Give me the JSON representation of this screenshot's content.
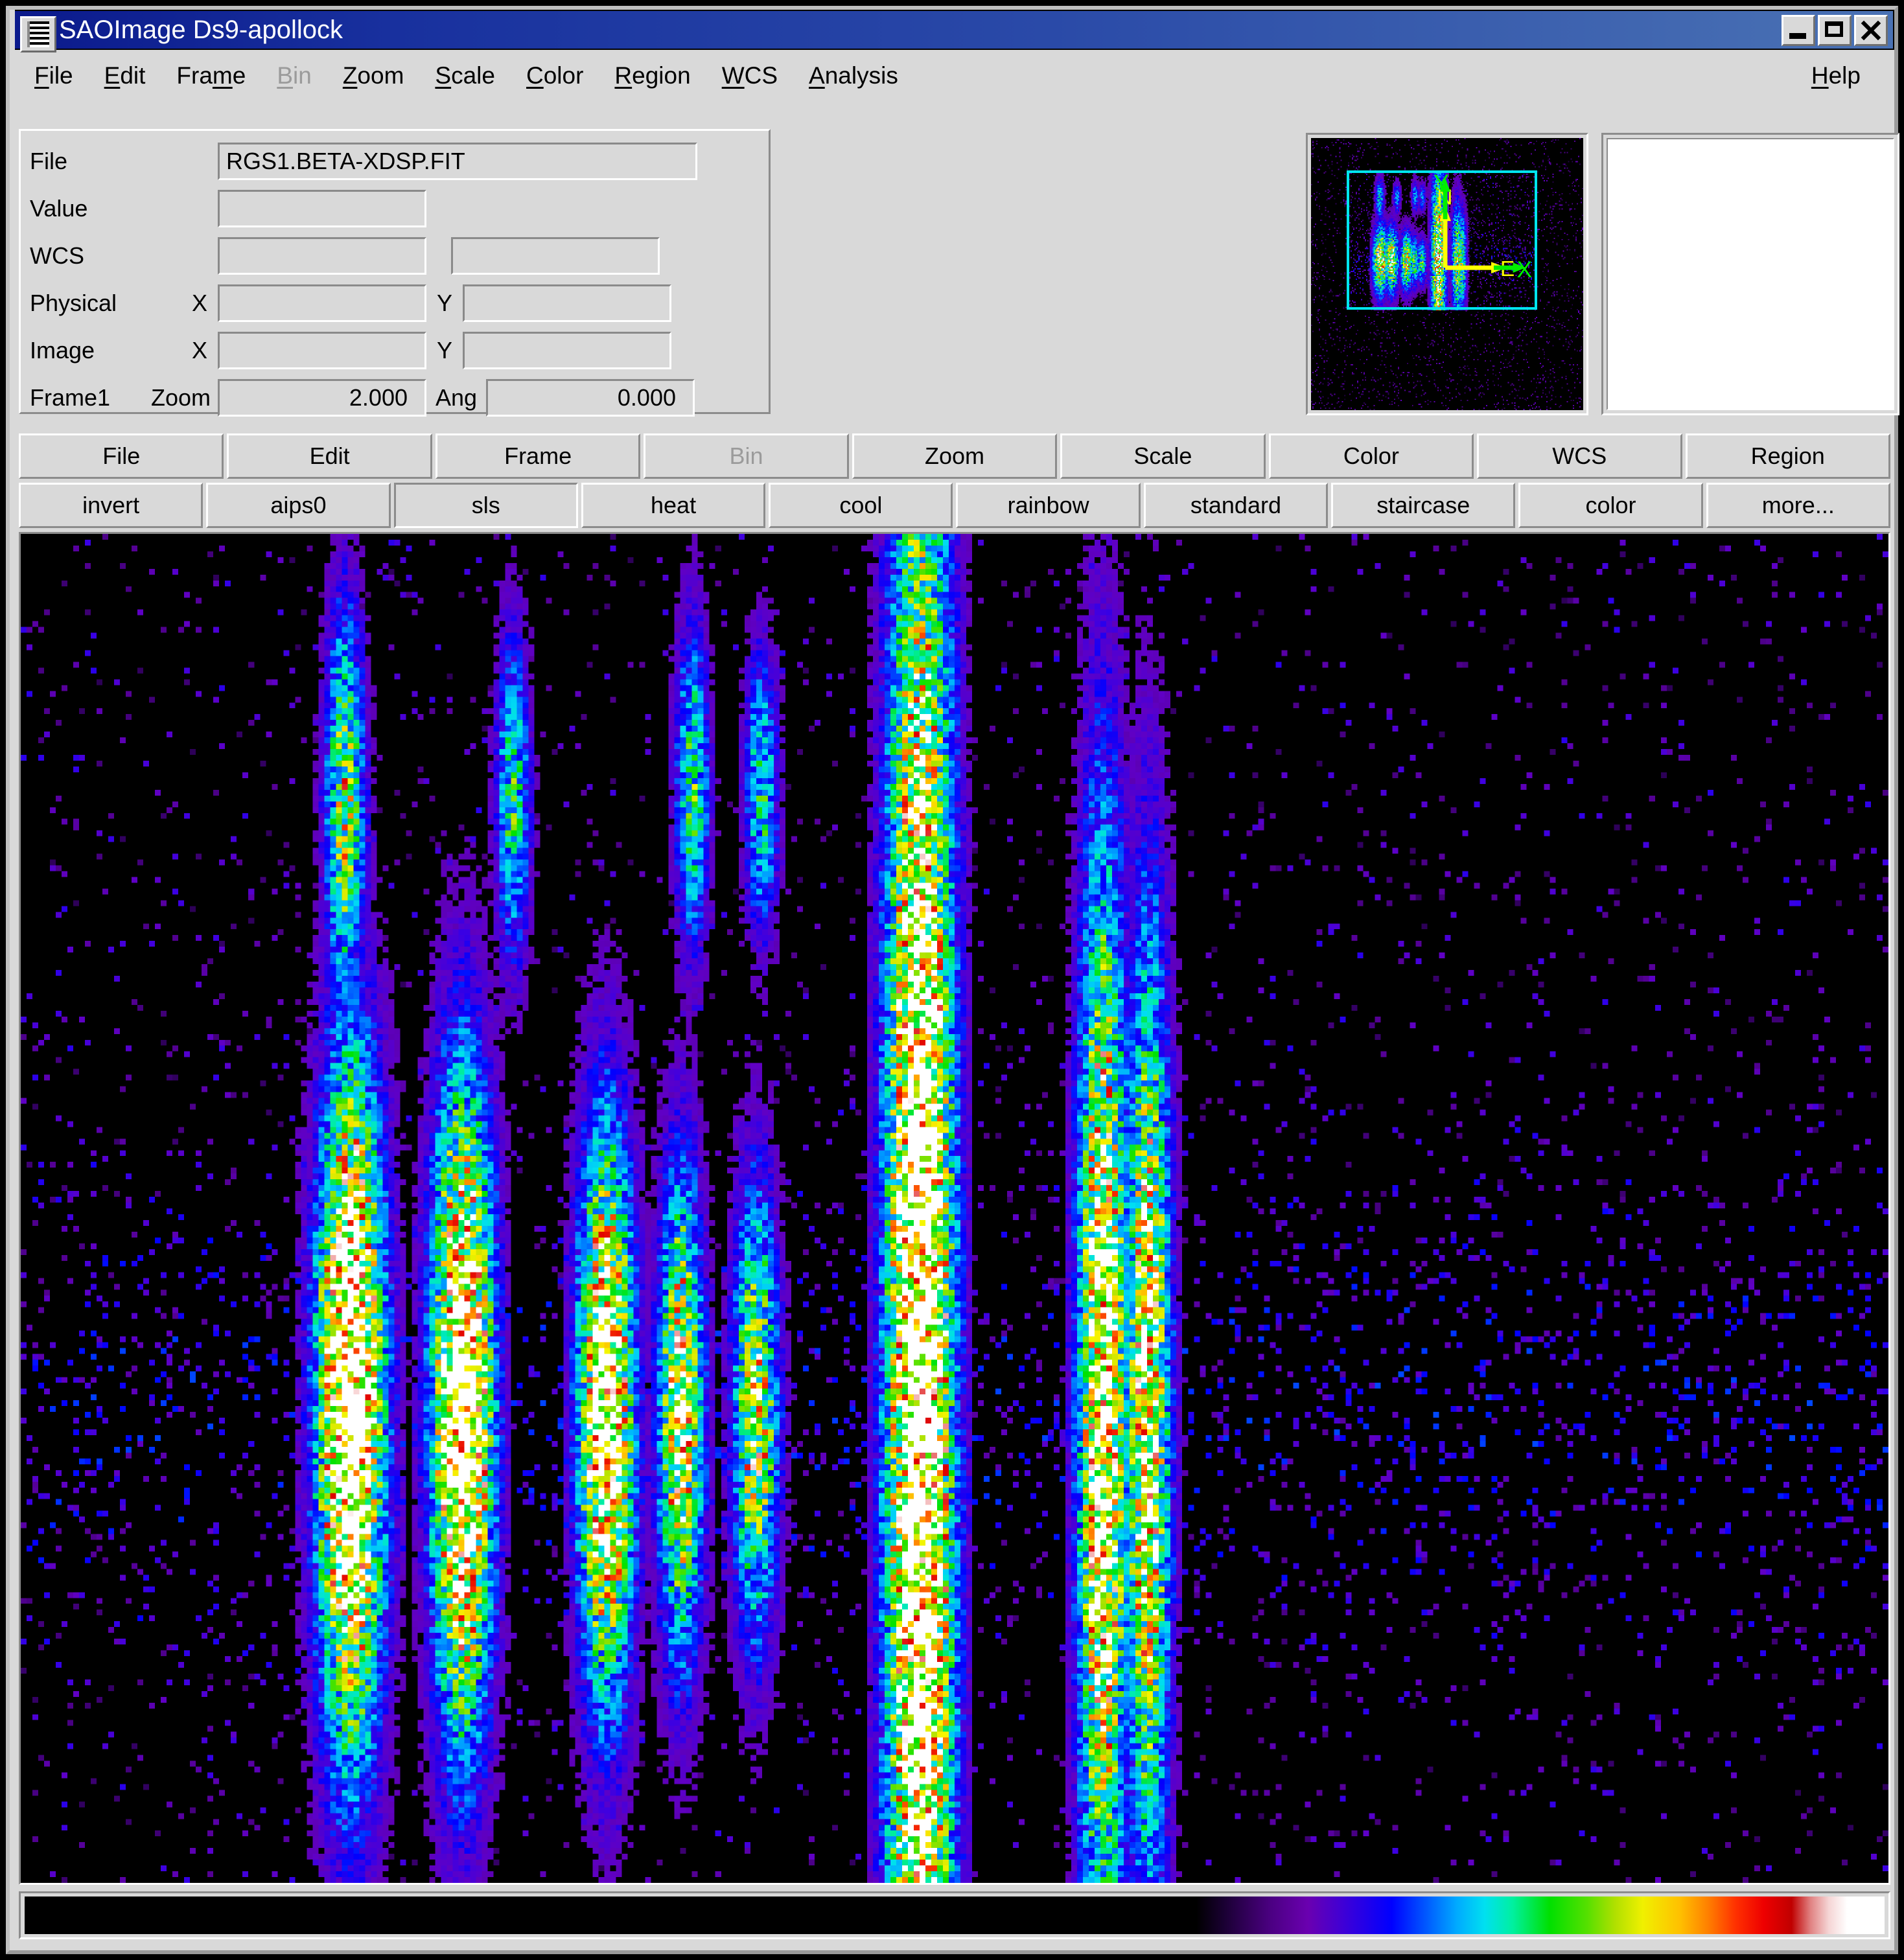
{
  "window": {
    "title": "SAOImage Ds9-apollock",
    "sysmenu_icon": "window-menu-icon",
    "buttons": {
      "minimize": "minimize-icon",
      "maximize": "maximize-icon",
      "close": "close-icon"
    }
  },
  "menubar": {
    "items": [
      {
        "label": "File",
        "accel": "F",
        "disabled": false
      },
      {
        "label": "Edit",
        "accel": "E",
        "disabled": false
      },
      {
        "label": "Frame",
        "accel": "m",
        "disabled": false
      },
      {
        "label": "Bin",
        "accel": "B",
        "disabled": true
      },
      {
        "label": "Zoom",
        "accel": "Z",
        "disabled": false
      },
      {
        "label": "Scale",
        "accel": "S",
        "disabled": false
      },
      {
        "label": "Color",
        "accel": "C",
        "disabled": false
      },
      {
        "label": "Region",
        "accel": "R",
        "disabled": false
      },
      {
        "label": "WCS",
        "accel": "W",
        "disabled": false
      },
      {
        "label": "Analysis",
        "accel": "A",
        "disabled": false
      }
    ],
    "help": {
      "label": "Help",
      "accel": "H"
    }
  },
  "info_panel": {
    "file_label": "File",
    "file_value": "RGS1.BETA-XDSP.FIT",
    "value_label": "Value",
    "value_value": "",
    "wcs_label": "WCS",
    "wcs_value1": "",
    "wcs_value2": "",
    "physical_label": "Physical",
    "physical_x_label": "X",
    "physical_x_value": "",
    "physical_y_label": "Y",
    "physical_y_value": "",
    "image_label": "Image",
    "image_x_label": "X",
    "image_x_value": "",
    "image_y_label": "Y",
    "image_y_value": "",
    "frame_label": "Frame1",
    "zoom_label": "Zoom",
    "zoom_value": "2.000",
    "ang_label": "Ang",
    "ang_value": "0.000"
  },
  "panner": {
    "compass_north": "N",
    "compass_east": "E",
    "axis_y": "Y",
    "axis_x": "X",
    "bbox_color": "#00e5ee",
    "wcs_arrow_color": "#ffff00",
    "image_arrow_color": "#00ee00"
  },
  "magnifier": {
    "content": ""
  },
  "button_row_1": [
    {
      "label": "File",
      "disabled": false,
      "active": false
    },
    {
      "label": "Edit",
      "disabled": false,
      "active": false
    },
    {
      "label": "Frame",
      "disabled": false,
      "active": false
    },
    {
      "label": "Bin",
      "disabled": true,
      "active": false
    },
    {
      "label": "Zoom",
      "disabled": false,
      "active": false
    },
    {
      "label": "Scale",
      "disabled": false,
      "active": false
    },
    {
      "label": "Color",
      "disabled": false,
      "active": false
    },
    {
      "label": "WCS",
      "disabled": false,
      "active": false
    },
    {
      "label": "Region",
      "disabled": false,
      "active": false
    }
  ],
  "button_row_2": [
    {
      "label": "invert",
      "disabled": false,
      "active": false
    },
    {
      "label": "aips0",
      "disabled": false,
      "active": false
    },
    {
      "label": "sls",
      "disabled": false,
      "active": true
    },
    {
      "label": "heat",
      "disabled": false,
      "active": false
    },
    {
      "label": "cool",
      "disabled": false,
      "active": false
    },
    {
      "label": "rainbow",
      "disabled": false,
      "active": false
    },
    {
      "label": "standard",
      "disabled": false,
      "active": false
    },
    {
      "label": "staircase",
      "disabled": false,
      "active": false
    },
    {
      "label": "color",
      "disabled": false,
      "active": false
    },
    {
      "label": "more...",
      "disabled": false,
      "active": false
    }
  ],
  "colorbar": {
    "colormap": "sls",
    "stops": [
      "#000000",
      "#4b0082",
      "#0000ff",
      "#00aaff",
      "#00e000",
      "#f0f000",
      "#ff8000",
      "#ee0000",
      "#ffffff"
    ]
  },
  "chart_data": {
    "type": "heatmap",
    "title": "RGS1.BETA-XDSP.FIT",
    "description": "XMM-Newton RGS1 cross-dispersion vs dispersion event image; vertical emission-line stripes on sparse background",
    "colormap": "sls",
    "zoom": 2.0,
    "angle": 0.0,
    "xlabel": "",
    "ylabel": "",
    "grid": false,
    "legend": "none",
    "stripes": [
      {
        "x_frac": 0.175,
        "bright": 1.0,
        "y_center_frac": 0.645,
        "width_frac": 0.012,
        "spread_frac": 0.17
      },
      {
        "x_frac": 0.235,
        "bright": 0.97,
        "y_center_frac": 0.645,
        "width_frac": 0.011,
        "spread_frac": 0.16
      },
      {
        "x_frac": 0.312,
        "bright": 0.88,
        "y_center_frac": 0.65,
        "width_frac": 0.01,
        "spread_frac": 0.14
      },
      {
        "x_frac": 0.352,
        "bright": 0.7,
        "y_center_frac": 0.65,
        "width_frac": 0.008,
        "spread_frac": 0.12
      },
      {
        "x_frac": 0.392,
        "bright": 0.62,
        "y_center_frac": 0.65,
        "width_frac": 0.008,
        "spread_frac": 0.11
      },
      {
        "x_frac": 0.48,
        "bright": 1.0,
        "y_center_frac": 0.645,
        "width_frac": 0.012,
        "spread_frac": 0.5
      },
      {
        "x_frac": 0.578,
        "bright": 0.8,
        "y_center_frac": 0.645,
        "width_frac": 0.009,
        "spread_frac": 0.28
      },
      {
        "x_frac": 0.602,
        "bright": 0.72,
        "y_center_frac": 0.648,
        "width_frac": 0.008,
        "spread_frac": 0.24
      },
      {
        "x_frac": 0.172,
        "bright": 0.52,
        "y_center_frac": 0.2,
        "width_frac": 0.007,
        "spread_frac": 0.1
      },
      {
        "x_frac": 0.262,
        "bright": 0.4,
        "y_center_frac": 0.195,
        "width_frac": 0.006,
        "spread_frac": 0.08
      },
      {
        "x_frac": 0.358,
        "bright": 0.42,
        "y_center_frac": 0.185,
        "width_frac": 0.006,
        "spread_frac": 0.08
      },
      {
        "x_frac": 0.395,
        "bright": 0.38,
        "y_center_frac": 0.19,
        "width_frac": 0.006,
        "spread_frac": 0.07
      }
    ],
    "background_band": {
      "y_center_frac": 0.645,
      "spread_frac": 0.11,
      "level": 0.3
    },
    "noise_level": 0.13
  }
}
